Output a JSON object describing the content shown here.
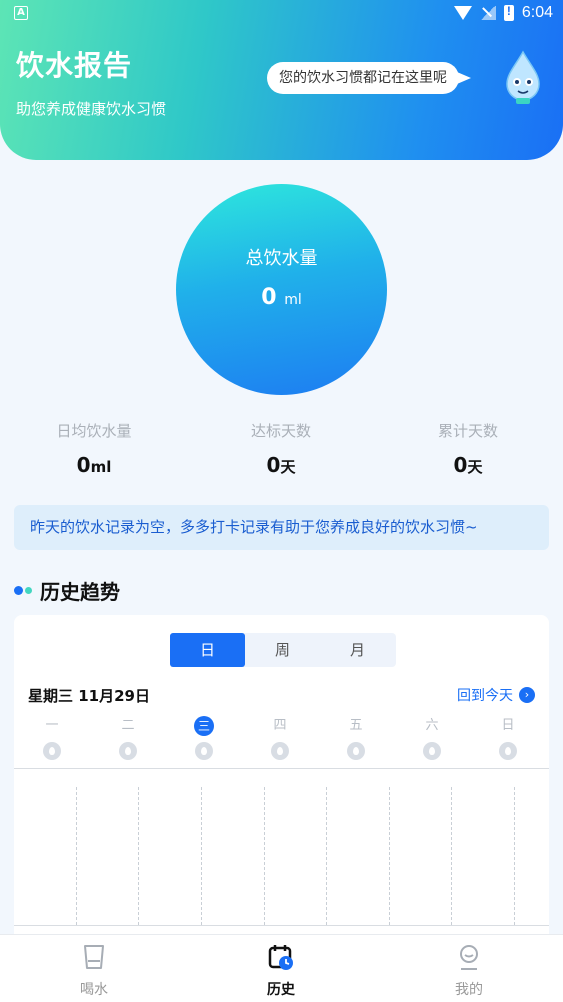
{
  "status_bar": {
    "left_icon": "A",
    "time": "6:04"
  },
  "header": {
    "title": "饮水报告",
    "subtitle": "助您养成健康饮水习惯",
    "bubble": "您的饮水习惯都记在这里呢"
  },
  "summary": {
    "label": "总饮水量",
    "value": "0",
    "unit": "ml"
  },
  "stats": [
    {
      "label": "日均饮水量",
      "value": "0",
      "unit": "ml"
    },
    {
      "label": "达标天数",
      "value": "0",
      "unit": "天"
    },
    {
      "label": "累计天数",
      "value": "0",
      "unit": "天"
    }
  ],
  "notice": "昨天的饮水记录为空，多多打卡记录有助于您养成良好的饮水习惯~",
  "section_title": "历史趋势",
  "tabs": [
    {
      "label": "日",
      "active": true
    },
    {
      "label": "周",
      "active": false
    },
    {
      "label": "月",
      "active": false
    }
  ],
  "date_label": "星期三 11月29日",
  "today_link": "回到今天",
  "weekdays": [
    "一",
    "二",
    "三",
    "四",
    "五",
    "六",
    "日"
  ],
  "today_index": 2,
  "nav": [
    {
      "label": "喝水",
      "icon": "cup-icon",
      "active": false
    },
    {
      "label": "历史",
      "icon": "calendar-clock-icon",
      "active": true
    },
    {
      "label": "我的",
      "icon": "user-icon",
      "active": false
    }
  ],
  "colors": {
    "accent": "#1a6ff5",
    "teal": "#2ee8dc"
  }
}
